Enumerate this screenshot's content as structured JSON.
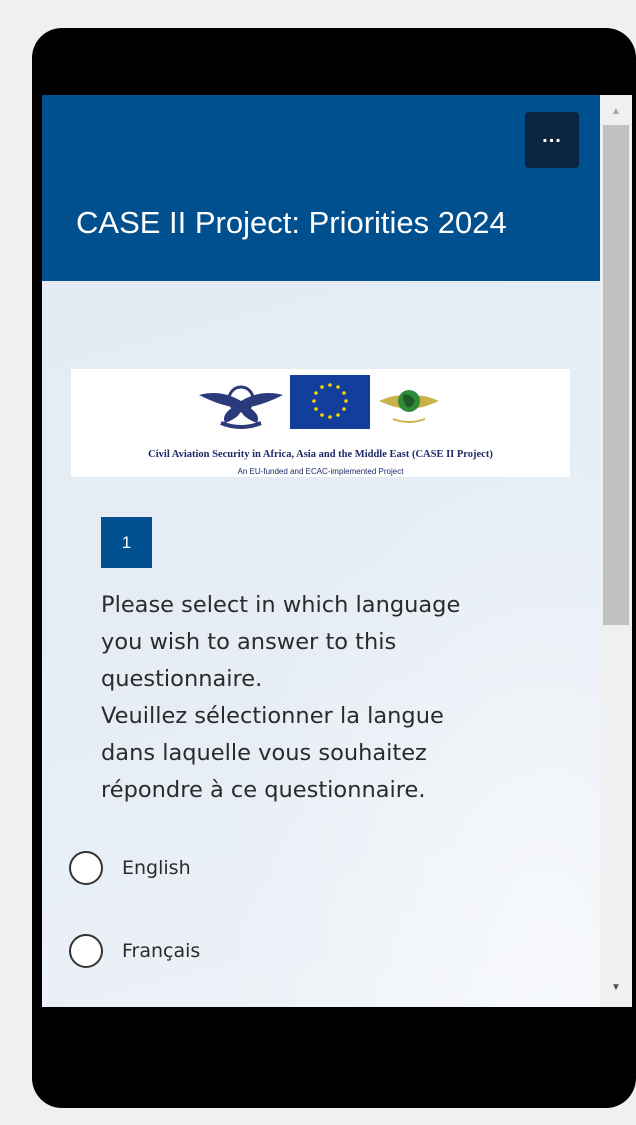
{
  "header": {
    "title": "CASE II Project: Priorities 2024",
    "more_label": "..."
  },
  "banner": {
    "title": "Civil Aviation Security in Africa, Asia and the Middle East (CASE II Project)",
    "subtitle": "An EU-funded and ECAC-implemented Project",
    "logos": [
      "ecac-logo",
      "eu-flag-logo",
      "afcac-logo"
    ]
  },
  "question": {
    "number": "1",
    "lines": [
      "Please select in which language",
      "you wish to answer to this",
      "questionnaire.",
      "Veuillez sélectionner la langue",
      "dans laquelle vous souhaitez",
      "répondre à ce questionnaire."
    ],
    "options": [
      "English",
      "Français"
    ]
  },
  "colors": {
    "header_blue": "#004f8f",
    "more_button": "#0b2440",
    "page_bg": "#e5ecf4",
    "device": "#000000"
  }
}
